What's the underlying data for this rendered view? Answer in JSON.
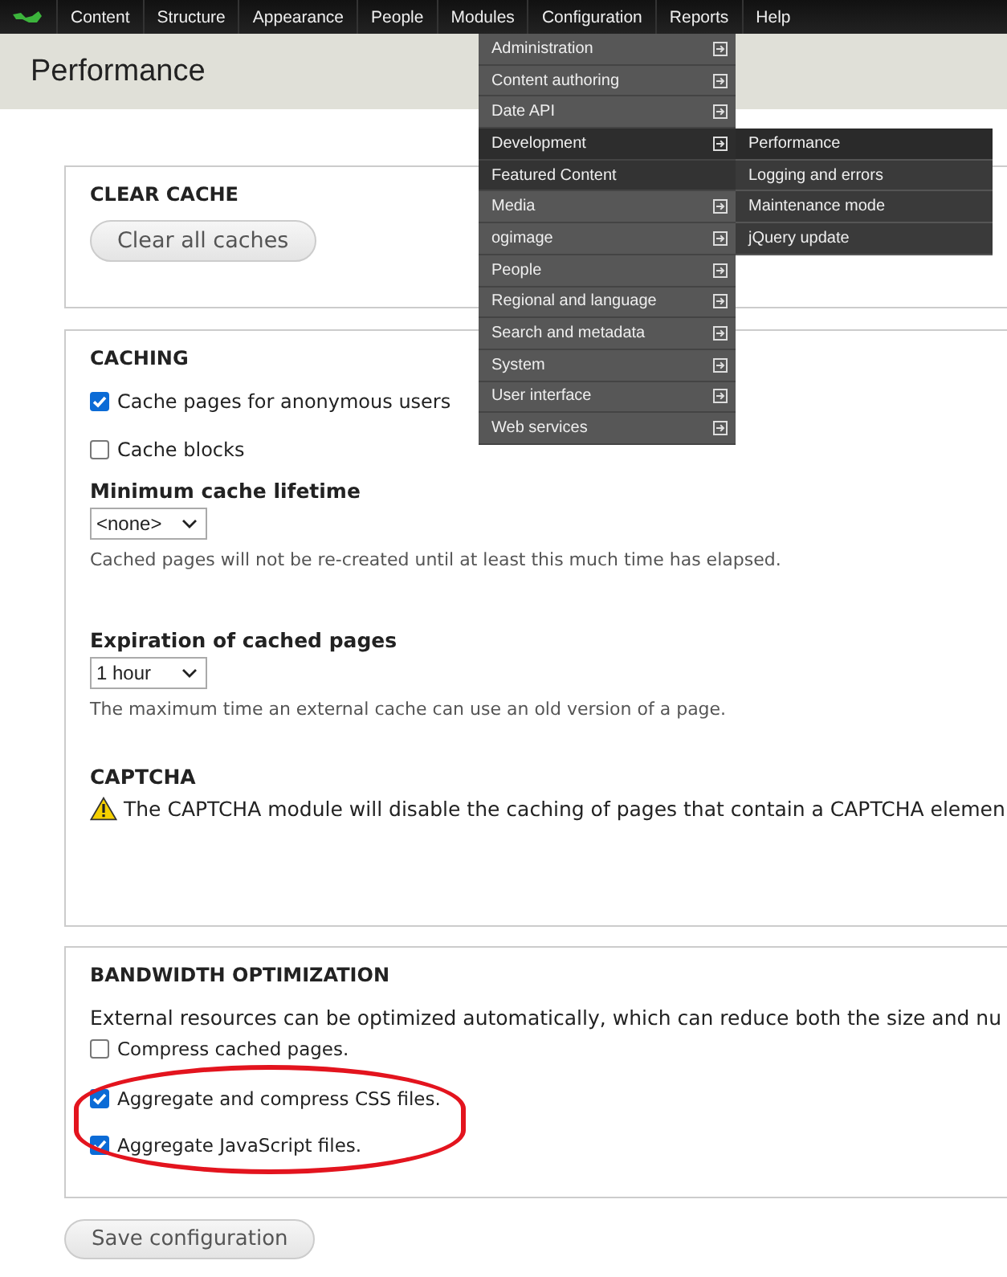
{
  "toolbar": {
    "items": [
      {
        "label": "Content"
      },
      {
        "label": "Structure"
      },
      {
        "label": "Appearance"
      },
      {
        "label": "People"
      },
      {
        "label": "Modules"
      },
      {
        "label": "Configuration"
      },
      {
        "label": "Reports"
      },
      {
        "label": "Help"
      }
    ]
  },
  "config_menu": {
    "items": [
      {
        "label": "Administration",
        "has_children": true,
        "selected": false
      },
      {
        "label": "Content authoring",
        "has_children": true,
        "selected": false
      },
      {
        "label": "Date API",
        "has_children": true,
        "selected": false
      },
      {
        "label": "Development",
        "has_children": true,
        "selected": true
      },
      {
        "label": "Featured Content",
        "has_children": false,
        "selected": false
      },
      {
        "label": "Media",
        "has_children": true,
        "selected": false
      },
      {
        "label": "ogimage",
        "has_children": true,
        "selected": false
      },
      {
        "label": "People",
        "has_children": true,
        "selected": false
      },
      {
        "label": "Regional and language",
        "has_children": true,
        "selected": false
      },
      {
        "label": "Search and metadata",
        "has_children": true,
        "selected": false
      },
      {
        "label": "System",
        "has_children": true,
        "selected": false
      },
      {
        "label": "User interface",
        "has_children": true,
        "selected": false
      },
      {
        "label": "Web services",
        "has_children": true,
        "selected": false
      }
    ]
  },
  "submenu": {
    "items": [
      {
        "label": "Performance",
        "selected": true
      },
      {
        "label": "Logging and errors",
        "selected": false
      },
      {
        "label": "Maintenance mode",
        "selected": false
      },
      {
        "label": "jQuery update",
        "selected": false
      }
    ]
  },
  "page": {
    "title": "Performance"
  },
  "clear_cache": {
    "legend": "CLEAR CACHE",
    "button": "Clear all caches"
  },
  "caching": {
    "legend": "CACHING",
    "checkboxes": [
      {
        "label": "Cache pages for anonymous users",
        "checked": true
      },
      {
        "label": "Cache blocks",
        "checked": false
      }
    ],
    "selects": [
      {
        "label": "Minimum cache lifetime",
        "value": "<none>",
        "description": "Cached pages will not be re-created until at least this much time has elapsed."
      },
      {
        "label": "Expiration of cached pages",
        "value": "1 hour",
        "description": "The maximum time an external cache can use an old version of a page."
      }
    ],
    "captcha": {
      "heading": "CAPTCHA",
      "message": "The CAPTCHA module will disable the caching of pages that contain a CAPTCHA elemen"
    }
  },
  "bandwidth": {
    "legend": "BANDWIDTH OPTIMIZATION",
    "description": "External resources can be optimized automatically, which can reduce both the size and nu",
    "checkboxes": [
      {
        "label": "Compress cached pages.",
        "checked": false
      },
      {
        "label": "Aggregate and compress CSS files.",
        "checked": true
      },
      {
        "label": "Aggregate JavaScript files.",
        "checked": true
      }
    ]
  },
  "save_button": "Save configuration"
}
